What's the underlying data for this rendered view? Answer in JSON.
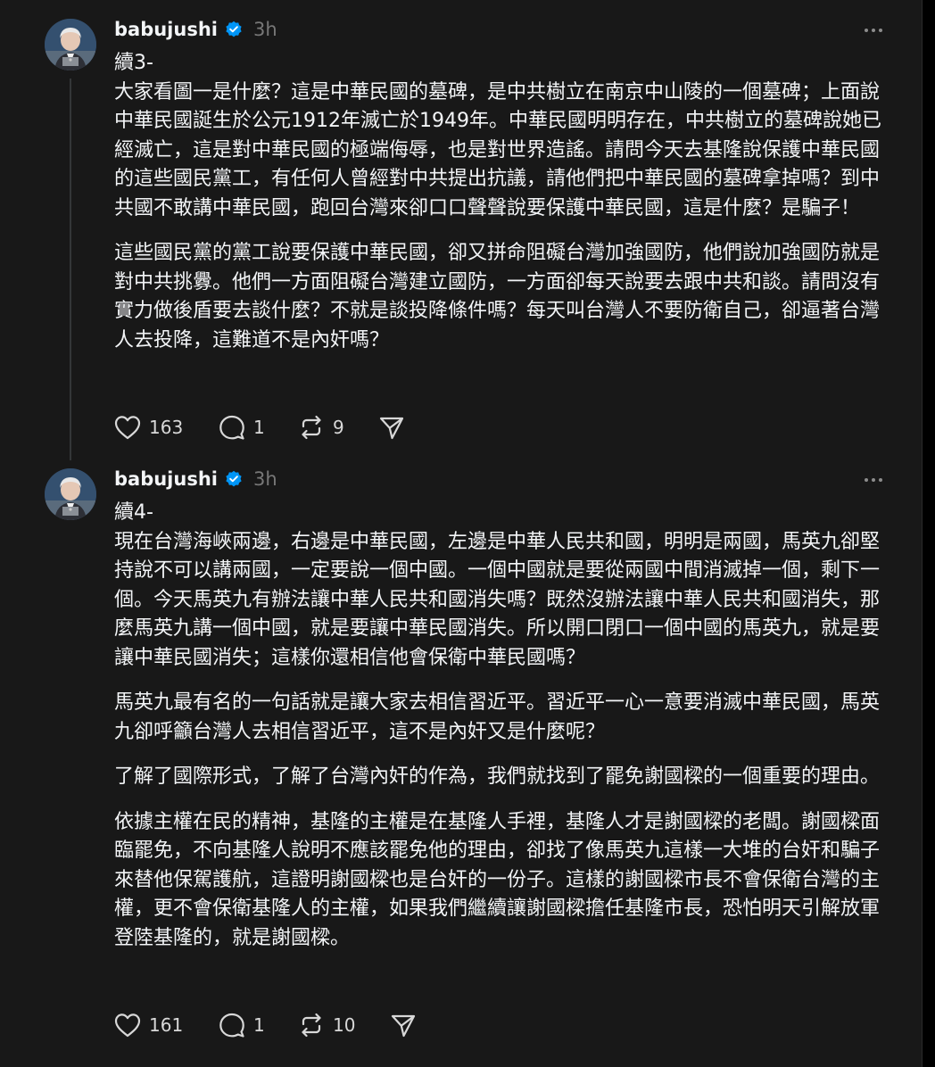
{
  "posts": [
    {
      "username": "babujushi",
      "time": "3h",
      "paragraphs": [
        "續3-",
        "大家看圖一是什麼？這是中華民國的墓碑，是中共樹立在南京中山陵的一個墓碑；上面說中華民國誕生於公元1912年滅亡於1949年。中華民國明明存在，中共樹立的墓碑說她已經滅亡，這是對中華民國的極端侮辱，也是對世界造謠。請問今天去基隆說保護中華民國的這些國民黨工，有任何人曾經對中共提出抗議，請他們把中華民國的墓碑拿掉嗎？到中共國不敢講中華民國，跑回台灣來卻口口聲聲說要保護中華民國，這是什麼？是騙子！",
        "這些國民黨的黨工說要保護中華民國，卻又拼命阻礙台灣加強國防，他們說加強國防就是對中共挑釁。他們一方面阻礙台灣建立國防，一方面卻每天說要去跟中共和談。請問沒有實力做後盾要去談什麼？不就是談投降條件嗎？每天叫台灣人不要防衛自己，卻逼著台灣人去投降，這難道不是內奸嗎？"
      ],
      "likes": "163",
      "replies": "1",
      "reposts": "9"
    },
    {
      "username": "babujushi",
      "time": "3h",
      "paragraphs": [
        "續4-",
        "現在台灣海峽兩邊，右邊是中華民國，左邊是中華人民共和國，明明是兩國，馬英九卻堅持說不可以講兩國，一定要說一個中國。一個中國就是要從兩國中間消滅掉一個，剩下一個。今天馬英九有辦法讓中華人民共和國消失嗎？既然沒辦法讓中華人民共和國消失，那麼馬英九講一個中國，就是要讓中華民國消失。所以開口閉口一個中國的馬英九，就是要讓中華民國消失；這樣你還相信他會保衛中華民國嗎？",
        "馬英九最有名的一句話就是讓大家去相信習近平。習近平一心一意要消滅中華民國，馬英九卻呼籲台灣人去相信習近平，這不是內奸又是什麼呢？",
        "了解了國際形式，了解了台灣內奸的作為，我們就找到了罷免謝國樑的一個重要的理由。",
        "依據主權在民的精神，基隆的主權是在基隆人手裡，基隆人才是謝國樑的老闆。謝國樑面臨罷免，不向基隆人說明不應該罷免他的理由，卻找了像馬英九這樣一大堆的台奸和騙子來替他保駕護航，這證明謝國樑也是台奸的一份子。這樣的謝國樑市長不會保衛台灣的主權，更不會保衛基隆人的主權，如果我們繼續讓謝國樑擔任基隆市長，恐怕明天引解放軍登陸基隆的，就是謝國樑。"
      ],
      "likes": "161",
      "replies": "1",
      "reposts": "10"
    }
  ],
  "icons": {
    "verified": "verified-badge-icon",
    "more": "more-options-icon",
    "like": "heart-icon",
    "reply": "comment-icon",
    "repost": "repost-icon",
    "share": "send-icon"
  },
  "colors": {
    "background": "#181818",
    "text": "#f3f5f7",
    "muted": "#777777",
    "verified": "#0095f6"
  }
}
